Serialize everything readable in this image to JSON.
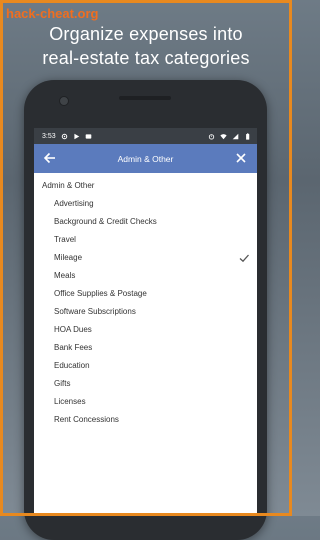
{
  "banner": {
    "watermark": "hack-cheat.org",
    "headline_line1": "Organize expenses into",
    "headline_line2": "real-estate tax categories"
  },
  "status_bar": {
    "time": "3:53",
    "icons_left": [
      "settings-icon",
      "play-icon",
      "message-icon"
    ],
    "icons_right": [
      "alarm-icon",
      "wifi-icon",
      "signal-icon",
      "battery-icon"
    ]
  },
  "app_bar": {
    "title": "Admin & Other",
    "back_icon": "arrow-left-icon",
    "close_icon": "close-icon",
    "color": "#5b7bbd"
  },
  "category_list": {
    "parent": "Admin & Other",
    "items": [
      {
        "label": "Advertising",
        "selected": false
      },
      {
        "label": "Background & Credit Checks",
        "selected": false
      },
      {
        "label": "Travel",
        "selected": false
      },
      {
        "label": "Mileage",
        "selected": true
      },
      {
        "label": "Meals",
        "selected": false
      },
      {
        "label": "Office Supplies & Postage",
        "selected": false
      },
      {
        "label": "Software Subscriptions",
        "selected": false
      },
      {
        "label": "HOA Dues",
        "selected": false
      },
      {
        "label": "Bank Fees",
        "selected": false
      },
      {
        "label": "Education",
        "selected": false
      },
      {
        "label": "Gifts",
        "selected": false
      },
      {
        "label": "Licenses",
        "selected": false
      },
      {
        "label": "Rent Concessions",
        "selected": false
      }
    ]
  },
  "colors": {
    "frame": "#e8891f",
    "watermark": "#f06e1f",
    "background": "#5b6670"
  }
}
